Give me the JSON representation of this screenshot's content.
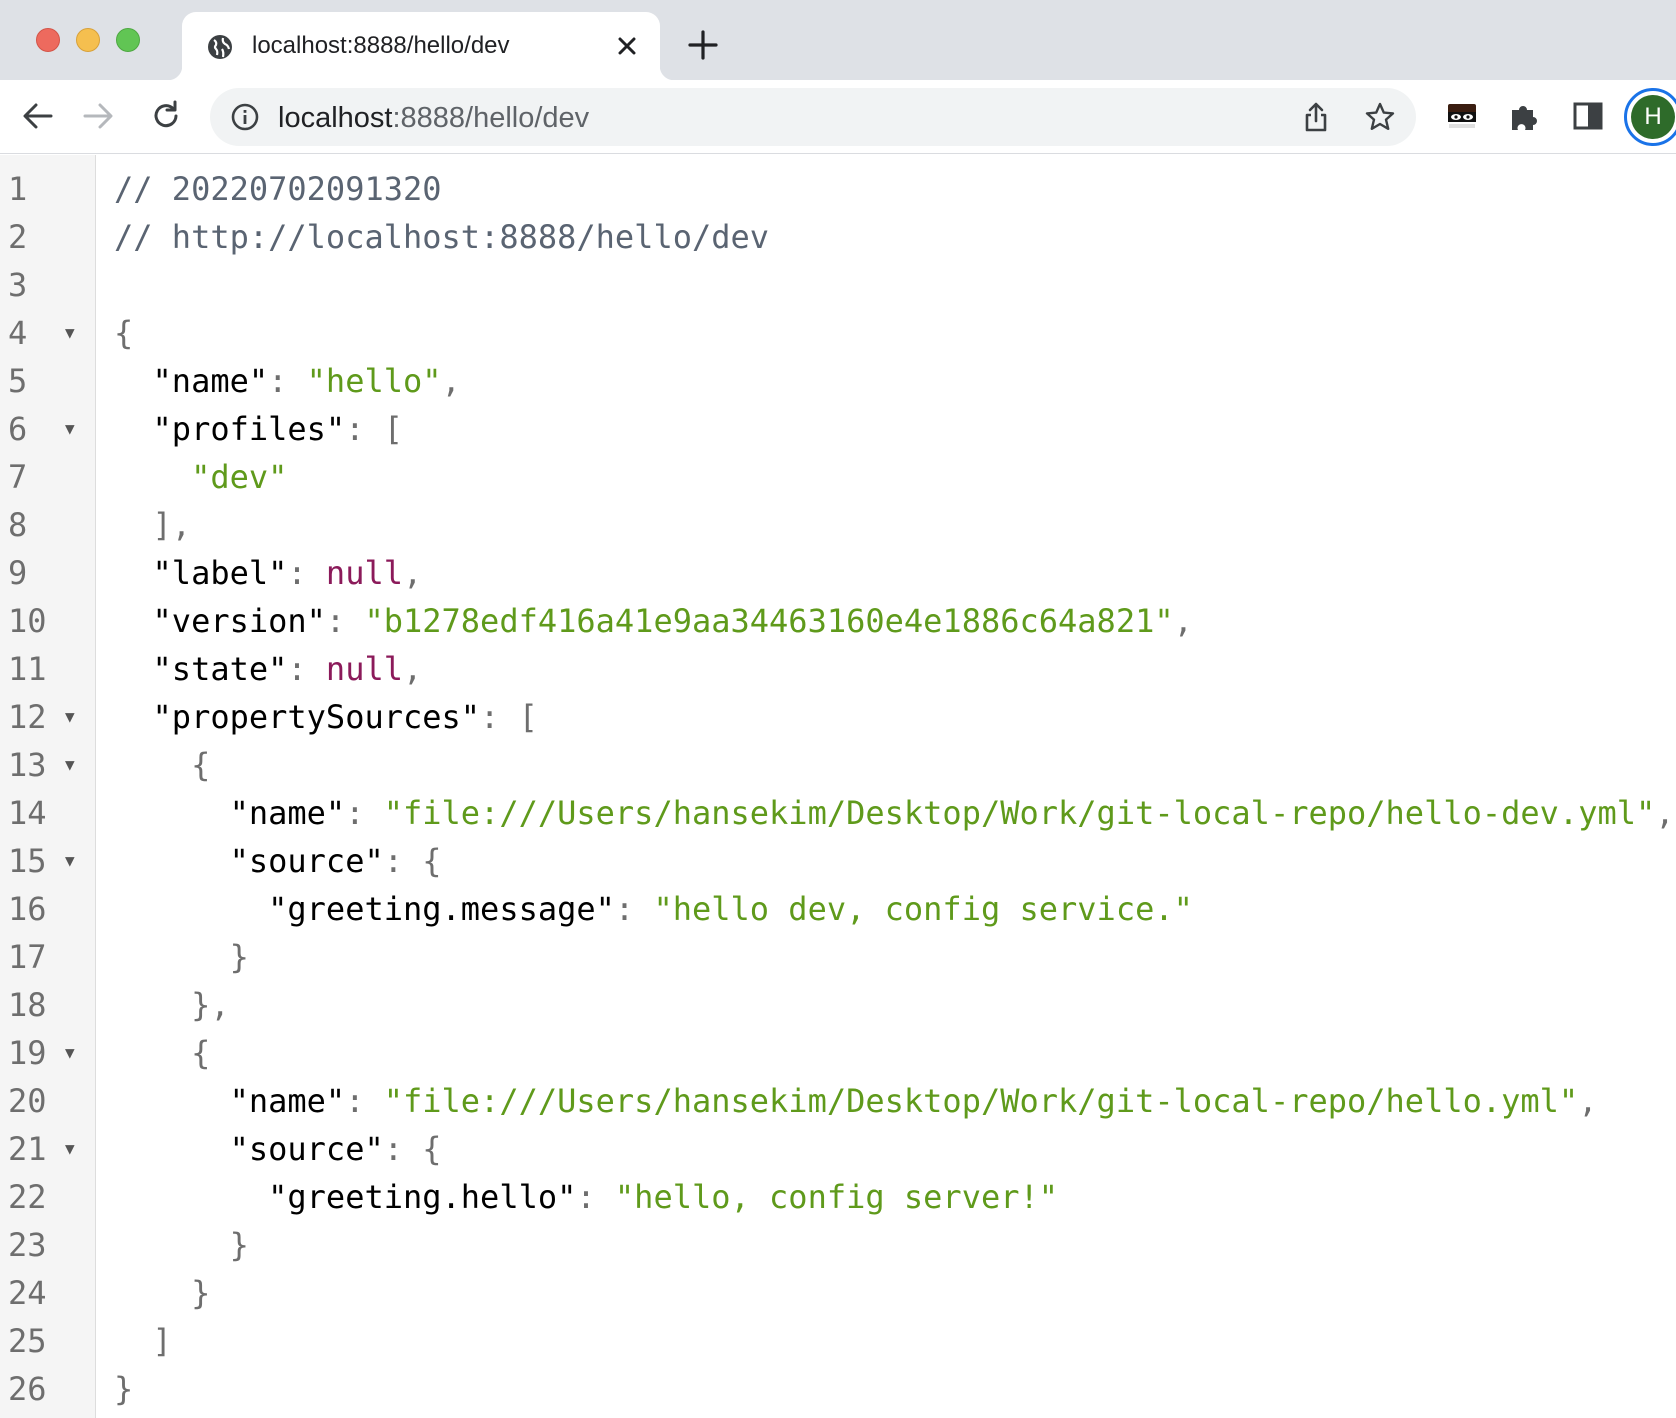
{
  "tab": {
    "title": "localhost:8888/hello/dev",
    "favicon": "globe-icon",
    "close_icon": "close-icon"
  },
  "new_tab_icon": "plus-icon",
  "toolbar": {
    "back_icon": "back-arrow-icon",
    "forward_icon": "forward-arrow-icon",
    "reload_icon": "reload-icon",
    "url_host": "localhost",
    "url_rest": ":8888/hello/dev",
    "info_icon": "info-icon",
    "share_icon": "share-icon",
    "bookmark_icon": "star-icon",
    "extension_icons": [
      "incognito-mask-icon",
      "puzzle-piece-icon",
      "side-panel-icon"
    ],
    "profile_initial": "H"
  },
  "colors": {
    "string": "#5f9a1b",
    "null": "#8b1a5a",
    "comment": "#5a6472",
    "avatar_bg": "#2e6b2a",
    "avatar_ring": "#1a73e8"
  },
  "lines": [
    {
      "n": "1",
      "fold": false,
      "parts": [
        [
          "c-comment",
          "// 20220702091320"
        ]
      ]
    },
    {
      "n": "2",
      "fold": false,
      "parts": [
        [
          "c-comment",
          "// http://localhost:8888/hello/dev"
        ]
      ]
    },
    {
      "n": "3",
      "fold": false,
      "parts": []
    },
    {
      "n": "4",
      "fold": true,
      "parts": [
        [
          "c-punc",
          "{"
        ]
      ]
    },
    {
      "n": "5",
      "fold": false,
      "parts": [
        [
          "c-key",
          "  \"name\""
        ],
        [
          "c-punc",
          ": "
        ],
        [
          "c-str",
          "\"hello\""
        ],
        [
          "c-punc",
          ","
        ]
      ]
    },
    {
      "n": "6",
      "fold": true,
      "parts": [
        [
          "c-key",
          "  \"profiles\""
        ],
        [
          "c-punc",
          ": ["
        ]
      ]
    },
    {
      "n": "7",
      "fold": false,
      "parts": [
        [
          "c-str",
          "    \"dev\""
        ]
      ]
    },
    {
      "n": "8",
      "fold": false,
      "parts": [
        [
          "c-punc",
          "  ],"
        ]
      ]
    },
    {
      "n": "9",
      "fold": false,
      "parts": [
        [
          "c-key",
          "  \"label\""
        ],
        [
          "c-punc",
          ": "
        ],
        [
          "c-null",
          "null"
        ],
        [
          "c-punc",
          ","
        ]
      ]
    },
    {
      "n": "10",
      "fold": false,
      "parts": [
        [
          "c-key",
          "  \"version\""
        ],
        [
          "c-punc",
          ": "
        ],
        [
          "c-str",
          "\"b1278edf416a41e9aa34463160e4e1886c64a821\""
        ],
        [
          "c-punc",
          ","
        ]
      ]
    },
    {
      "n": "11",
      "fold": false,
      "parts": [
        [
          "c-key",
          "  \"state\""
        ],
        [
          "c-punc",
          ": "
        ],
        [
          "c-null",
          "null"
        ],
        [
          "c-punc",
          ","
        ]
      ]
    },
    {
      "n": "12",
      "fold": true,
      "parts": [
        [
          "c-key",
          "  \"propertySources\""
        ],
        [
          "c-punc",
          ": ["
        ]
      ]
    },
    {
      "n": "13",
      "fold": true,
      "parts": [
        [
          "c-punc",
          "    {"
        ]
      ]
    },
    {
      "n": "14",
      "fold": false,
      "parts": [
        [
          "c-key",
          "      \"name\""
        ],
        [
          "c-punc",
          ": "
        ],
        [
          "c-str",
          "\"file:///Users/hansekim/Desktop/Work/git-local-repo/hello-dev.yml\""
        ],
        [
          "c-punc",
          ","
        ]
      ]
    },
    {
      "n": "15",
      "fold": true,
      "parts": [
        [
          "c-key",
          "      \"source\""
        ],
        [
          "c-punc",
          ": {"
        ]
      ]
    },
    {
      "n": "16",
      "fold": false,
      "parts": [
        [
          "c-key",
          "        \"greeting.message\""
        ],
        [
          "c-punc",
          ": "
        ],
        [
          "c-str",
          "\"hello dev, config service.\""
        ]
      ]
    },
    {
      "n": "17",
      "fold": false,
      "parts": [
        [
          "c-punc",
          "      }"
        ]
      ]
    },
    {
      "n": "18",
      "fold": false,
      "parts": [
        [
          "c-punc",
          "    },"
        ]
      ]
    },
    {
      "n": "19",
      "fold": true,
      "parts": [
        [
          "c-punc",
          "    {"
        ]
      ]
    },
    {
      "n": "20",
      "fold": false,
      "parts": [
        [
          "c-key",
          "      \"name\""
        ],
        [
          "c-punc",
          ": "
        ],
        [
          "c-str",
          "\"file:///Users/hansekim/Desktop/Work/git-local-repo/hello.yml\""
        ],
        [
          "c-punc",
          ","
        ]
      ]
    },
    {
      "n": "21",
      "fold": true,
      "parts": [
        [
          "c-key",
          "      \"source\""
        ],
        [
          "c-punc",
          ": {"
        ]
      ]
    },
    {
      "n": "22",
      "fold": false,
      "parts": [
        [
          "c-key",
          "        \"greeting.hello\""
        ],
        [
          "c-punc",
          ": "
        ],
        [
          "c-str",
          "\"hello, config server!\""
        ]
      ]
    },
    {
      "n": "23",
      "fold": false,
      "parts": [
        [
          "c-punc",
          "      }"
        ]
      ]
    },
    {
      "n": "24",
      "fold": false,
      "parts": [
        [
          "c-punc",
          "    }"
        ]
      ]
    },
    {
      "n": "25",
      "fold": false,
      "parts": [
        [
          "c-punc",
          "  ]"
        ]
      ]
    },
    {
      "n": "26",
      "fold": false,
      "parts": [
        [
          "c-punc",
          "}"
        ]
      ]
    }
  ]
}
